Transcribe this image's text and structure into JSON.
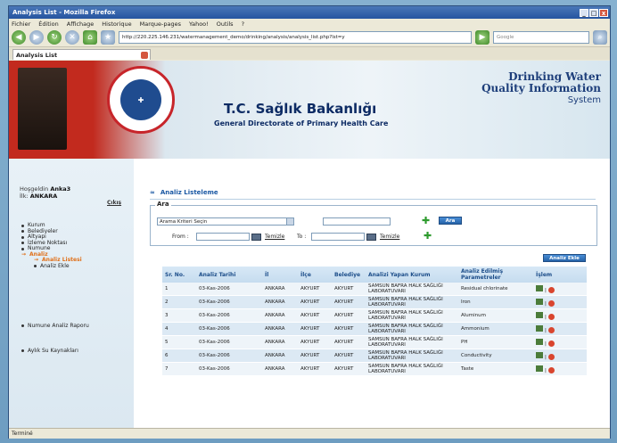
{
  "window": {
    "title": "Analysis List - Mozilla Firefox"
  },
  "menubar": [
    "Fichier",
    "Édition",
    "Affichage",
    "Historique",
    "Marque-pages",
    "Yahoo!",
    "Outils",
    "?"
  ],
  "navbar": {
    "url": "http://220.225.146.231/watermanagement_demo/drinking/analysis/analysis_list.php?lst=y",
    "search_placeholder": "Google"
  },
  "tab": {
    "label": "Analysis List"
  },
  "banner": {
    "title": "T.C. Sağlık Bakanlığı",
    "subtitle": "General Directorate of Primary Health Care",
    "right_line1": "Drinking Water",
    "right_line2": "Quality Information",
    "right_line3": "System",
    "seal_text": "T.C. SAĞLIK BAKANLIĞI"
  },
  "sidebar": {
    "greeting_label": "Hoşgeldin",
    "user": "Anka3",
    "province_label": "İlk:",
    "province": "ANKARA",
    "logout": "Çıkış",
    "items": [
      {
        "label": "Kurum"
      },
      {
        "label": "Belediyeler"
      },
      {
        "label": "Altyapı"
      },
      {
        "label": "İzleme Noktası"
      },
      {
        "label": "Numune"
      },
      {
        "label": "Analiz"
      },
      {
        "label": "Analiz Listesi"
      },
      {
        "label": "Analiz Ekle"
      }
    ],
    "bottom_items": [
      {
        "label": "Numune Analiz Raporu"
      },
      {
        "label": "Aylık Su Kaynakları"
      }
    ]
  },
  "main": {
    "section_title": "Analiz Listeleme",
    "search_legend": "Ara",
    "search_select": "Arama Kriteri Seçin",
    "search_button": "Ara",
    "from_label": "From :",
    "to_label": "To :",
    "clear_link": "Temizle",
    "add_button": "Analiz Ekle"
  },
  "table": {
    "headers": [
      "Sr. No.",
      "Analiz Tarihi",
      "İl",
      "İlçe",
      "Belediye",
      "Analizi Yapan Kurum",
      "Analiz Edilmiş Parametreler",
      "İşlem"
    ],
    "rows": [
      [
        "1",
        "03-Kas-2006",
        "ANKARA",
        "AKYURT",
        "AKYURT",
        "SAMSUN BAFRA HALK SAĞLIĞI LABORATUVARI",
        "Residual chlorinate"
      ],
      [
        "2",
        "03-Kas-2006",
        "ANKARA",
        "AKYURT",
        "AKYURT",
        "SAMSUN BAFRA HALK SAĞLIĞI LABORATUVARI",
        "Iron"
      ],
      [
        "3",
        "03-Kas-2006",
        "ANKARA",
        "AKYURT",
        "AKYURT",
        "SAMSUN BAFRA HALK SAĞLIĞI LABORATUVARI",
        "Aluminum"
      ],
      [
        "4",
        "03-Kas-2006",
        "ANKARA",
        "AKYURT",
        "AKYURT",
        "SAMSUN BAFRA HALK SAĞLIĞI LABORATUVARI",
        "Ammonium"
      ],
      [
        "5",
        "03-Kas-2006",
        "ANKARA",
        "AKYURT",
        "AKYURT",
        "SAMSUN BAFRA HALK SAĞLIĞI LABORATUVARI",
        "PH"
      ],
      [
        "6",
        "03-Kas-2006",
        "ANKARA",
        "AKYURT",
        "AKYURT",
        "SAMSUN BAFRA HALK SAĞLIĞI LABORATUVARI",
        "Conductivity"
      ],
      [
        "7",
        "03-Kas-2006",
        "ANKARA",
        "AKYURT",
        "AKYURT",
        "SAMSUN BAFRA HALK SAĞLIĞI LABORATUVARI",
        "Taste"
      ]
    ]
  },
  "status": {
    "text": "Terminé"
  }
}
